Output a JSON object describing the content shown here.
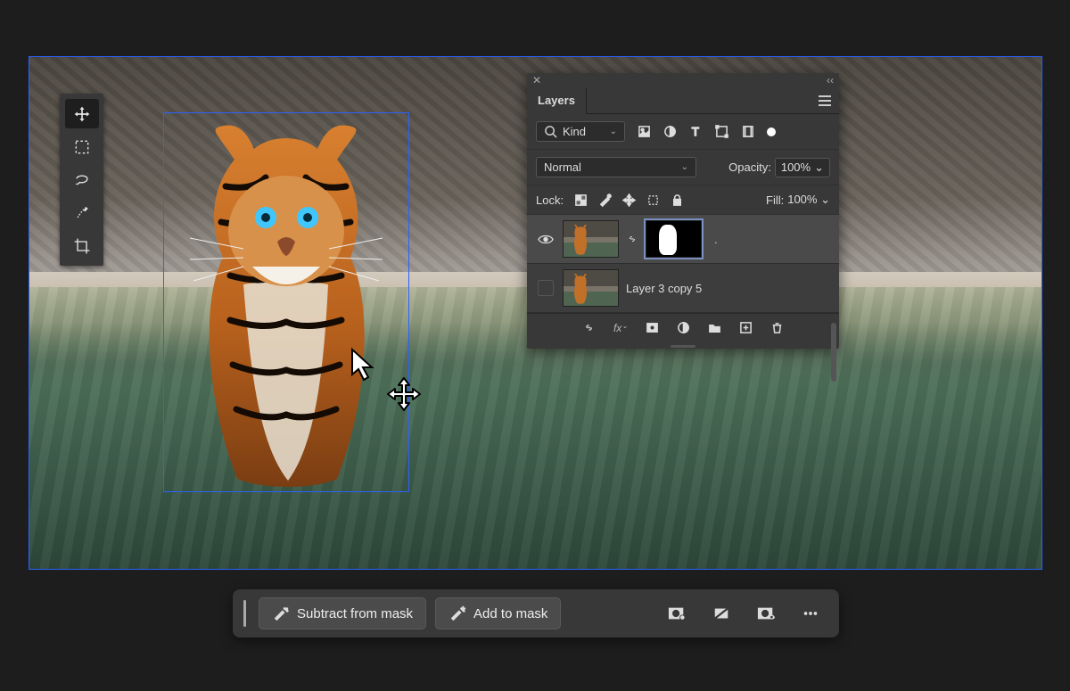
{
  "toolbox": {
    "items": [
      {
        "name": "move-tool",
        "selected": true
      },
      {
        "name": "marquee-tool",
        "selected": false
      },
      {
        "name": "lasso-tool",
        "selected": false
      },
      {
        "name": "quick-select-tool",
        "selected": false
      },
      {
        "name": "crop-tool",
        "selected": false
      }
    ]
  },
  "layers_panel": {
    "tab_label": "Layers",
    "filter": {
      "kind_label": "Kind"
    },
    "blend_mode": "Normal",
    "opacity": {
      "label": "Opacity:",
      "value": "100%"
    },
    "lock_label": "Lock:",
    "fill": {
      "label": "Fill:",
      "value": "100%"
    },
    "layers": [
      {
        "name": "",
        "visible": true,
        "masked": true,
        "active": true
      },
      {
        "name": "Layer 3 copy 5",
        "visible": false,
        "masked": false,
        "active": false
      }
    ]
  },
  "action_bar": {
    "subtract_label": "Subtract from mask",
    "add_label": "Add to mask"
  }
}
